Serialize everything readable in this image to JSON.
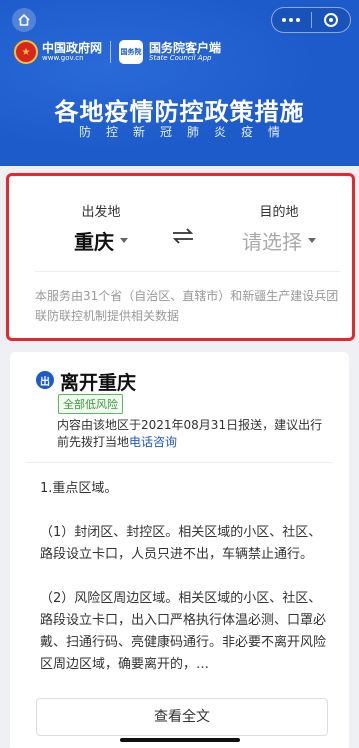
{
  "header": {
    "gov_name": "中国政府网",
    "gov_url": "www.gov.cn",
    "emblem_glyph": "★",
    "app_icon_text": "国务院",
    "app_name": "国务院客户端",
    "app_en": "State Council App",
    "title": "各地疫情防控政策措施",
    "subtitle": "防控新冠肺炎疫情",
    "bg_color": "#1c5bc9"
  },
  "search": {
    "from_label": "出发地",
    "from_value": "重庆",
    "to_label": "目的地",
    "to_value": "请选择",
    "notice": "本服务由31个省（自治区、直辖市）和新疆生产建设兵团联防联控机制提供相关数据",
    "highlight_color": "#e8262c"
  },
  "result": {
    "badge": "出",
    "title": "离开重庆",
    "risk_tag": "全部低风险",
    "report_text": "内容由该地区于2021年08月31日报送，建议出行前先拨打当地",
    "report_link": "电话咨询",
    "policy": [
      "1.重点区域。",
      "（1）封闭区、封控区。相关区域的小区、社区、路段设立卡口，人员只进不出，车辆禁止通行。",
      "（2）风险区周边区域。相关区域的小区、社区、路段设立卡口，出入口严格执行体温必测、口罩必戴、扫通行码、亮健康码通行。非必要不离开风险区周边区域，确要离开的，…"
    ],
    "view_all": "查看全文"
  }
}
